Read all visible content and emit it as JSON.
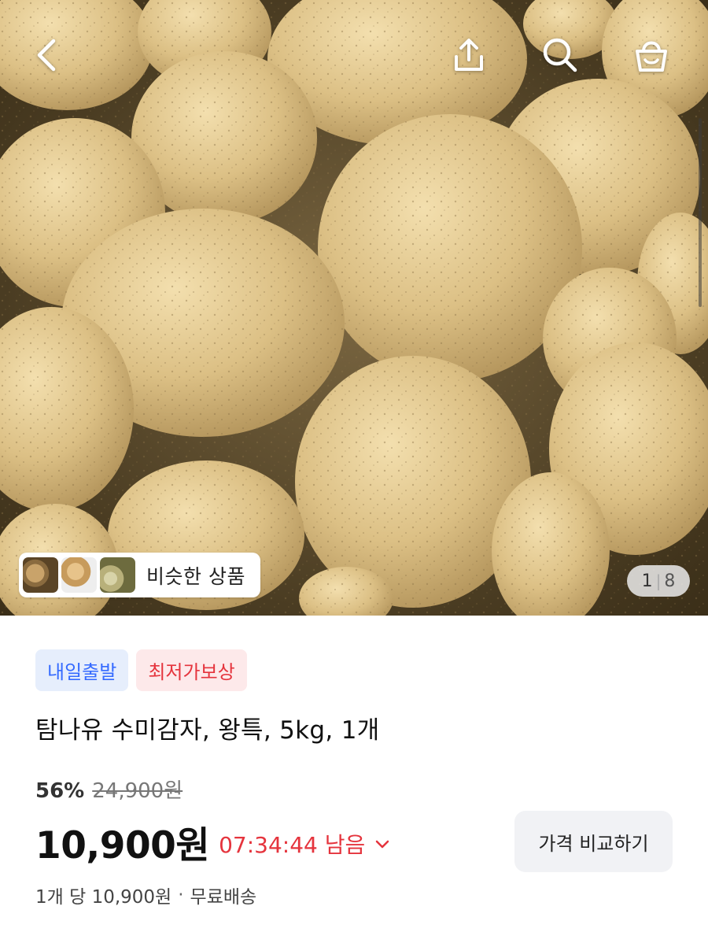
{
  "hero": {
    "icons": {
      "back": "back-chevron-icon",
      "share": "share-icon",
      "search": "search-icon",
      "cart": "shopping-bag-icon"
    },
    "similar_label": "비슷한 상품",
    "page_current": "1",
    "page_total": "8"
  },
  "badges": [
    {
      "label": "내일출발",
      "color": "#346aff"
    },
    {
      "label": "최저가보상",
      "color": "#e5343d"
    }
  ],
  "product": {
    "title": "탐나유 수미감자, 왕특, 5kg, 1개",
    "discount": "56%",
    "original_price": "24,900원",
    "price": "10,900원",
    "timer": "07:34:44 남음",
    "compare_label": "가격 비교하기",
    "unit_price": "1개 당 10,900원",
    "shipping": "무료배송"
  },
  "colors": {
    "accent_red": "#e5343d",
    "accent_blue": "#346aff"
  }
}
